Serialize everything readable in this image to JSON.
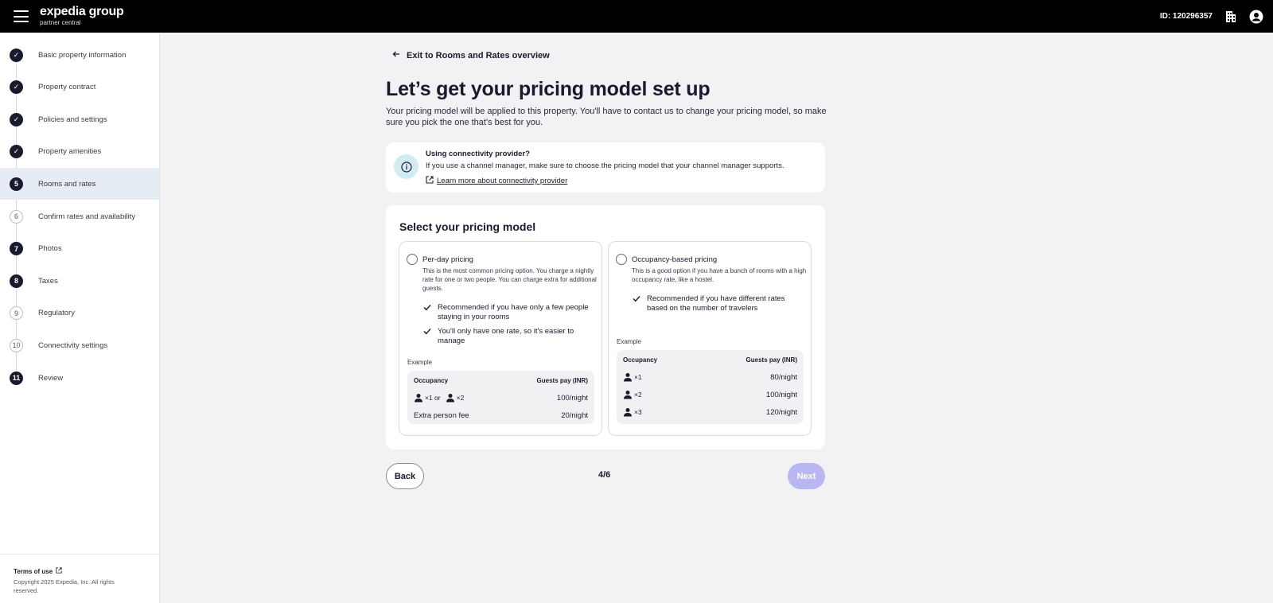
{
  "header": {
    "logo_main": "expedia group",
    "logo_sub": "partner central",
    "property_id": "ID: 120296357",
    "icons": [
      "menu-icon",
      "building-icon",
      "account-icon"
    ]
  },
  "sidebar": {
    "steps": [
      {
        "marker": "✓",
        "label": "Basic property information",
        "state": "done"
      },
      {
        "marker": "✓",
        "label": "Property contract",
        "state": "done"
      },
      {
        "marker": "✓",
        "label": "Policies and settings",
        "state": "done"
      },
      {
        "marker": "✓",
        "label": "Property amenities",
        "state": "done"
      },
      {
        "marker": "5",
        "label": "Rooms and rates",
        "state": "active"
      },
      {
        "marker": "6",
        "label": "Confirm rates and availability",
        "state": "todo"
      },
      {
        "marker": "7",
        "label": "Photos",
        "state": "num"
      },
      {
        "marker": "8",
        "label": "Taxes",
        "state": "num"
      },
      {
        "marker": "9",
        "label": "Regulatory",
        "state": "todo"
      },
      {
        "marker": "10",
        "label": "Connectivity settings",
        "state": "todo"
      },
      {
        "marker": "11",
        "label": "Review",
        "state": "num"
      }
    ],
    "footer": {
      "terms": "Terms of use",
      "copyright": "Copyright 2025 Expedia, Inc. All rights reserved."
    }
  },
  "main": {
    "exit_link": "Exit to Rooms and Rates overview",
    "title": "Let’s get your pricing model set up",
    "description": "Your pricing model will be applied to this property. You'll have to contact us to change your pricing model, so make sure you pick the one that's best for you.",
    "info": {
      "title": "Using connectivity provider?",
      "text": "If you use a channel manager, make sure to choose the pricing model that your channel manager supports.",
      "link": "Learn more about connectivity provider"
    },
    "select_title": "Select your pricing model",
    "options": [
      {
        "title": "Per-day pricing",
        "description": "This is the most common pricing option. You charge a nightly rate for one or two people. You can charge extra for additional guests.",
        "bullets": [
          "Recommended if you have only a few people staying in your rooms",
          "You'll only have one rate, so it's easier to manage"
        ],
        "example_label": "Example",
        "table_head": [
          "Occupancy",
          "Guests pay (INR)"
        ],
        "rows": [
          {
            "occ_a": "×1 or",
            "occ_b": "×2",
            "price": "100/night"
          },
          {
            "label": "Extra person fee",
            "price": "20/night"
          }
        ]
      },
      {
        "title": "Occupancy-based pricing",
        "description": "This is a good option if you have a bunch of rooms with a high occupancy rate, like a hostel.",
        "bullets": [
          "Recommended if you have different rates based on the number of travelers"
        ],
        "example_label": "Example",
        "table_head": [
          "Occupancy",
          "Guests pay (INR)"
        ],
        "rows": [
          {
            "occ": "×1",
            "price": "80/night"
          },
          {
            "occ": "×2",
            "price": "100/night"
          },
          {
            "occ": "×3",
            "price": "120/night"
          }
        ]
      }
    ],
    "nav": {
      "back": "Back",
      "page": "4/6",
      "next": "Next"
    }
  },
  "colors": {
    "header_bg": "#000000",
    "active_step_bg": "#e6ecf4",
    "info_icon_bg": "#d3ecf4",
    "next_disabled": "#b9b7f2"
  }
}
